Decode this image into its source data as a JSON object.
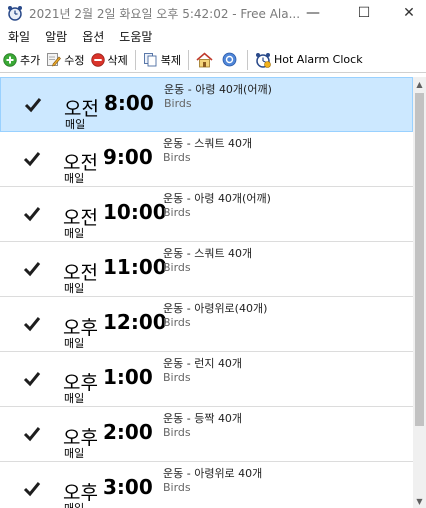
{
  "window": {
    "title": "2021년 2월 2일 화요일 오후 5:42:02 - Free Ala...",
    "minimize_glyph": "—",
    "maximize_glyph": "☐",
    "close_glyph": "✕"
  },
  "menu": [
    "화일",
    "알람",
    "옵션",
    "도움말"
  ],
  "toolbar": {
    "add_label": "추가",
    "edit_label": "수정",
    "delete_label": "삭제",
    "copy_label": "복제",
    "hot_alarm_label": "Hot Alarm Clock",
    "home_icon": "home-icon",
    "help_icon": "help-icon"
  },
  "alarms": [
    {
      "ampm": "오전",
      "time": "8:00",
      "repeat": "매일",
      "label": "운동 - 아령 40개(어깨)",
      "sound": "Birds",
      "checked": true,
      "selected": true
    },
    {
      "ampm": "오전",
      "time": "9:00",
      "repeat": "매일",
      "label": "운동 - 스쿼트 40개",
      "sound": "Birds",
      "checked": true,
      "selected": false
    },
    {
      "ampm": "오전",
      "time": "10:00",
      "repeat": "매일",
      "label": "운동 - 아령 40개(어깨)",
      "sound": "Birds",
      "checked": true,
      "selected": false
    },
    {
      "ampm": "오전",
      "time": "11:00",
      "repeat": "매일",
      "label": "운동 - 스쿼트 40개",
      "sound": "Birds",
      "checked": true,
      "selected": false
    },
    {
      "ampm": "오후",
      "time": "12:00",
      "repeat": "매일",
      "label": "운동 - 아령위로(40개)",
      "sound": "Birds",
      "checked": true,
      "selected": false
    },
    {
      "ampm": "오후",
      "time": "1:00",
      "repeat": "매일",
      "label": "운동 - 런지 40개",
      "sound": "Birds",
      "checked": true,
      "selected": false
    },
    {
      "ampm": "오후",
      "time": "2:00",
      "repeat": "매일",
      "label": "운동 - 등짝 40개",
      "sound": "Birds",
      "checked": true,
      "selected": false
    },
    {
      "ampm": "오후",
      "time": "3:00",
      "repeat": "매일",
      "label": "운동 - 아령위로 40개",
      "sound": "Birds",
      "checked": true,
      "selected": false
    }
  ],
  "colors": {
    "selection_bg": "#cce8ff",
    "selection_border": "#99d1ff",
    "add_green": "#3aa935",
    "delete_red": "#d9342b"
  }
}
